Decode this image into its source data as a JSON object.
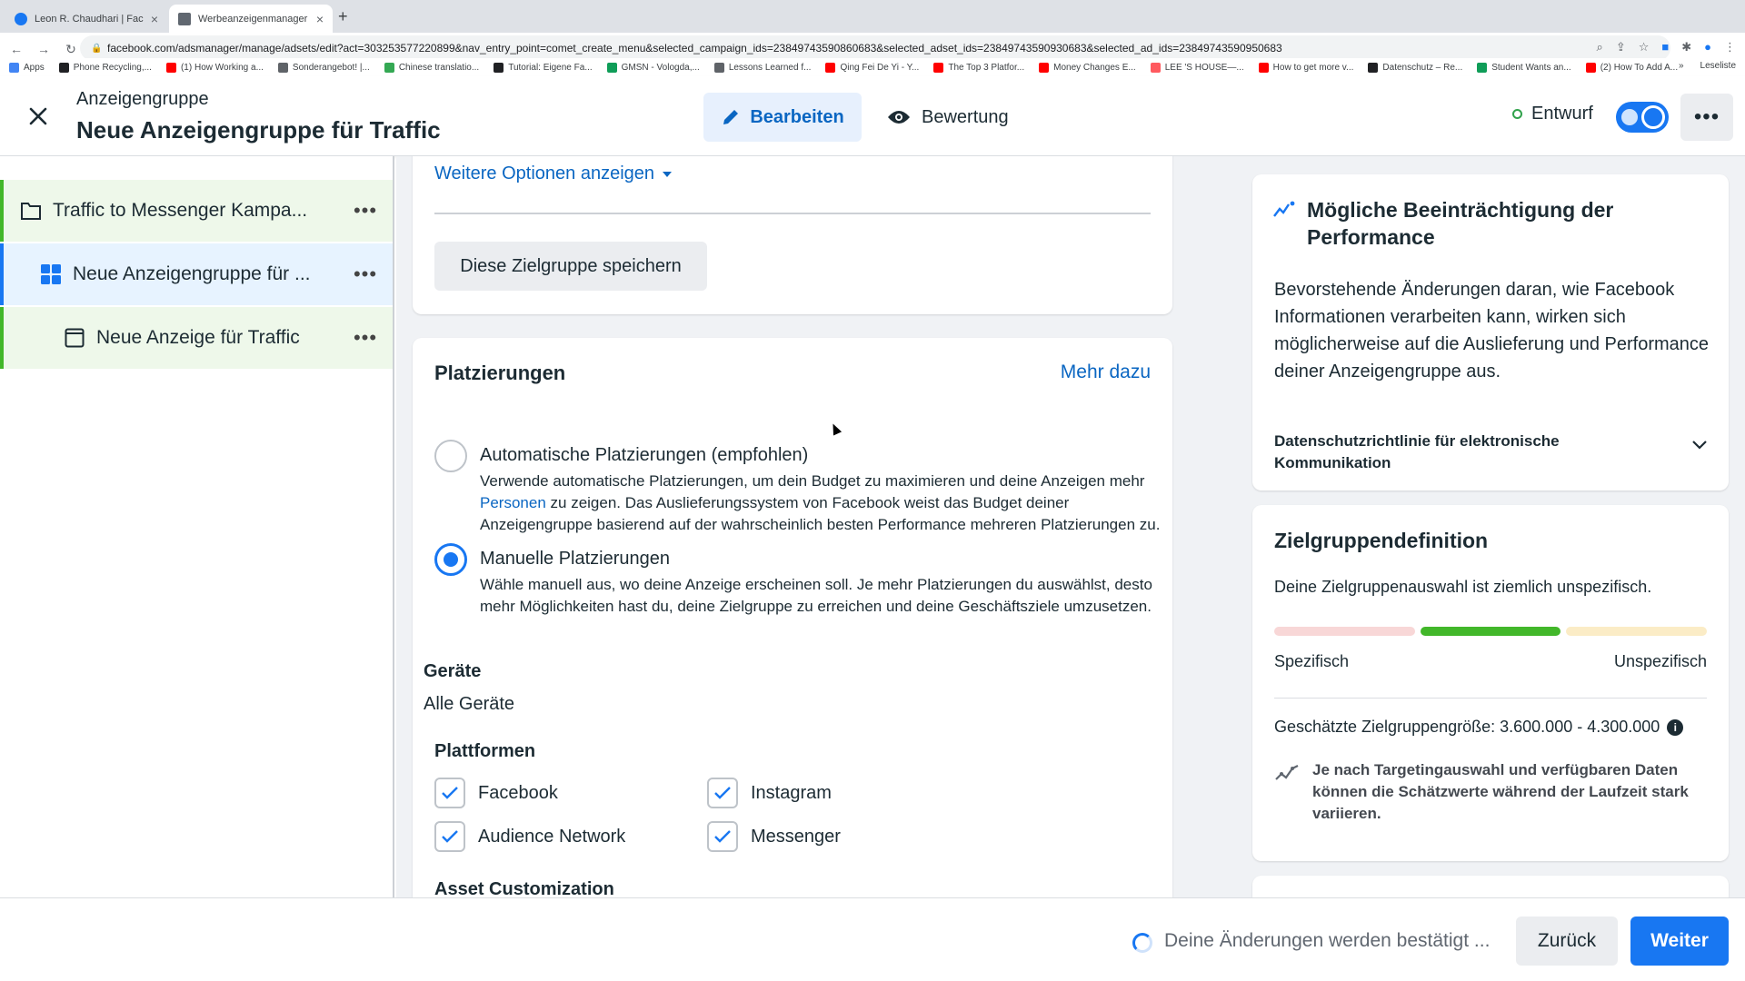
{
  "browser": {
    "tabs": [
      {
        "label": "Leon R. Chaudhari | Facebook",
        "active": false,
        "favicon_color": "#1877f2"
      },
      {
        "label": "Werbeanzeigenmanager - Wer",
        "active": true,
        "favicon_color": "#606770"
      }
    ],
    "url": "facebook.com/adsmanager/manage/adsets/edit?act=303253577220899&nav_entry_point=comet_create_menu&selected_campaign_ids=23849743590860683&selected_adset_ids=23849743590930683&selected_ad_ids=23849743590950683",
    "bookmarks": [
      {
        "label": "Apps",
        "color": "#4285f4"
      },
      {
        "label": "Phone Recycling,...",
        "color": "#202124"
      },
      {
        "label": "(1) How Working a...",
        "color": "#ff0000"
      },
      {
        "label": "Sonderangebot! |...",
        "color": "#5f6368"
      },
      {
        "label": "Chinese translatio...",
        "color": "#34a853"
      },
      {
        "label": "Tutorial: Eigene Fa...",
        "color": "#202124"
      },
      {
        "label": "GMSN - Vologda,...",
        "color": "#0f9d58"
      },
      {
        "label": "Lessons Learned f...",
        "color": "#5f6368"
      },
      {
        "label": "Qing Fei De Yi - Y...",
        "color": "#ff0000"
      },
      {
        "label": "The Top 3 Platfor...",
        "color": "#ff0000"
      },
      {
        "label": "Money Changes E...",
        "color": "#ff0000"
      },
      {
        "label": "LEE 'S HOUSE—...",
        "color": "#ff5a5f"
      },
      {
        "label": "How to get more v...",
        "color": "#ff0000"
      },
      {
        "label": "Datenschutz – Re...",
        "color": "#202124"
      },
      {
        "label": "Student Wants an...",
        "color": "#0f9d58"
      },
      {
        "label": "(2) How To Add A...",
        "color": "#ff0000"
      }
    ],
    "reading_list": "Leseliste"
  },
  "header": {
    "subtitle": "Anzeigengruppe",
    "title": "Neue Anzeigengruppe für Traffic",
    "edit_label": "Bearbeiten",
    "review_label": "Bewertung",
    "status_label": "Entwurf",
    "toggle_on": true
  },
  "tree": [
    {
      "label": "Traffic to Messenger Kampa...",
      "type": "campaign"
    },
    {
      "label": "Neue Anzeigengruppe für ...",
      "type": "adset"
    },
    {
      "label": "Neue Anzeige für Traffic",
      "type": "ad"
    }
  ],
  "audience_card": {
    "more_options": "Weitere Optionen anzeigen",
    "save_audience": "Diese Zielgruppe speichern"
  },
  "placements": {
    "title": "Platzierungen",
    "learn_more": "Mehr dazu",
    "auto": {
      "title": "Automatische Platzierungen (empfohlen)",
      "desc_before_link": "Verwende automatische Platzierungen, um dein Budget zu maximieren und deine Anzeigen mehr",
      "link": "Personen",
      "desc_after_link": "zu zeigen. Das Auslieferungssystem von Facebook weist das Budget deiner Anzeigengruppe basierend auf der wahrscheinlich besten Performance mehreren Platzierungen zu.",
      "selected": false
    },
    "manual": {
      "title": "Manuelle Platzierungen",
      "desc": "Wähle manuell aus, wo deine Anzeige erscheinen soll. Je mehr Platzierungen du auswählst, desto mehr Möglichkeiten hast du, deine Zielgruppe zu erreichen und deine Geschäftsziele umzusetzen.",
      "selected": true
    },
    "devices_label": "Geräte",
    "devices_value": "Alle Geräte",
    "platforms_label": "Plattformen",
    "platforms": [
      {
        "label": "Facebook",
        "checked": true
      },
      {
        "label": "Instagram",
        "checked": true
      },
      {
        "label": "Audience Network",
        "checked": true
      },
      {
        "label": "Messenger",
        "checked": true
      }
    ],
    "asset_label": "Asset Customization"
  },
  "performance_card": {
    "title": "Mögliche Beeinträchtigung der Performance",
    "body": "Bevorstehende Änderungen daran, wie Facebook Informationen verarbeiten kann, wirken sich möglicherweise auf die Auslieferung und Performance deiner Anzeigengruppe aus.",
    "policy": "Datenschutzrichtlinie für elektronische Kommunikation"
  },
  "audience_def": {
    "title": "Zielgruppendefinition",
    "body": "Deine Zielgruppenauswahl ist ziemlich unspezifisch.",
    "meter_colors": [
      "#f8d7d7",
      "#42b72a",
      "#fbecc6"
    ],
    "meter_level": "middle",
    "left_label": "Spezifisch",
    "right_label": "Unspezifisch",
    "estimate": "Geschätzte Zielgruppengröße: 3.600.000 - 4.300.000",
    "note": "Je nach Targetingauswahl und verfügbaren Daten können die Schätzwerte während der Laufzeit stark variieren."
  },
  "footer": {
    "status": "Deine Änderungen werden bestätigt ...",
    "back": "Zurück",
    "next": "Weiter"
  },
  "colors": {
    "accent": "#1877f2",
    "link": "#0a66c2",
    "status_green": "#31a24c"
  }
}
